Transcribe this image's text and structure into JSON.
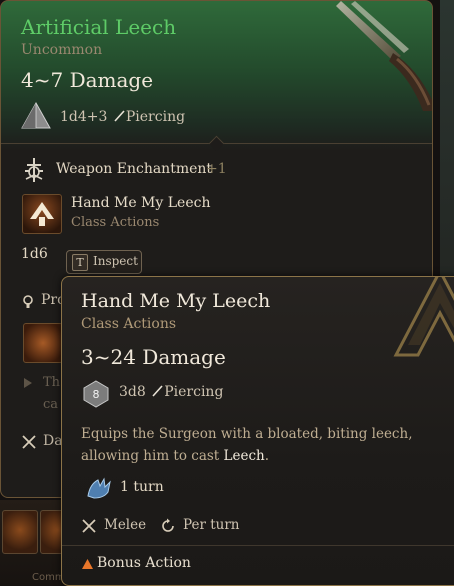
{
  "item": {
    "name": "Artificial Leech",
    "rarity": "Uncommon",
    "damage": "4~7 Damage",
    "dice": "1d4+3",
    "damage_type": "Piercing",
    "enchantment_label": "Weapon Enchantment",
    "enchantment_bonus": "+1",
    "action_name": "Hand Me My Leech",
    "action_category": "Class Actions",
    "extra_die": "1d6",
    "inspect_key": "T",
    "inspect_label": "Inspect",
    "partial_proficiency": "Pro",
    "partial_faded_1": "Th",
    "partial_faded_2": "ca",
    "partial_da": "Da"
  },
  "action": {
    "name": "Hand Me My Leech",
    "category": "Class Actions",
    "damage": "3~24 Damage",
    "die_number": "8",
    "dice": "3d8",
    "damage_type": "Piercing",
    "description_prefix": "Equips the Surgeon with a bloated, biting leech, allowing him to cast ",
    "description_highlight": "Leech",
    "description_suffix": ".",
    "duration": "1 turn",
    "tag_melee": "Melee",
    "tag_per_turn": "Per turn",
    "cost": "Bonus Action"
  },
  "colors": {
    "title_green": "#5ecb67",
    "header_green": "#2f6a3a",
    "border_gold": "#8c7448",
    "bonus_action": "#e8762a"
  },
  "icons": {
    "die": "d4-die-icon",
    "sword": "piercing-icon",
    "enchant": "enchantment-icon",
    "action": "leech-action-icon",
    "duration": "duration-hand-icon",
    "melee": "crossed-swords-icon",
    "per_turn": "refresh-icon",
    "bonus": "triangle-icon"
  }
}
